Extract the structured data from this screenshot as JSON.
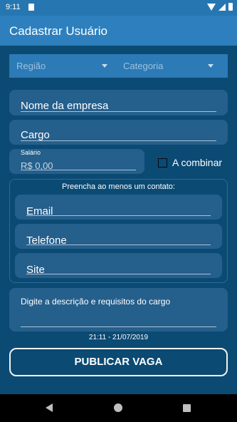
{
  "status_bar": {
    "time": "9:11"
  },
  "app_bar": {
    "title": "Cadastrar Usuário"
  },
  "filters": {
    "region_label": "Região",
    "category_label": "Categoria"
  },
  "form": {
    "company_name": "Nome da empresa",
    "position": "Cargo",
    "salary_label": "Salário",
    "salary_value": "R$ 0,00",
    "negotiable_label": "A combinar",
    "contact_title": "Preencha ao menos um contato:",
    "email": "Email",
    "phone": "Telefone",
    "site": "Site",
    "description": "Digite a descrição e requisitos do cargo"
  },
  "timestamp": "21:11  -  21/07/2019",
  "publish_button": "PUBLICAR VAGA",
  "colors": {
    "background": "#0b4a73",
    "app_bar": "#2d80bd",
    "field": "#255f8c"
  }
}
